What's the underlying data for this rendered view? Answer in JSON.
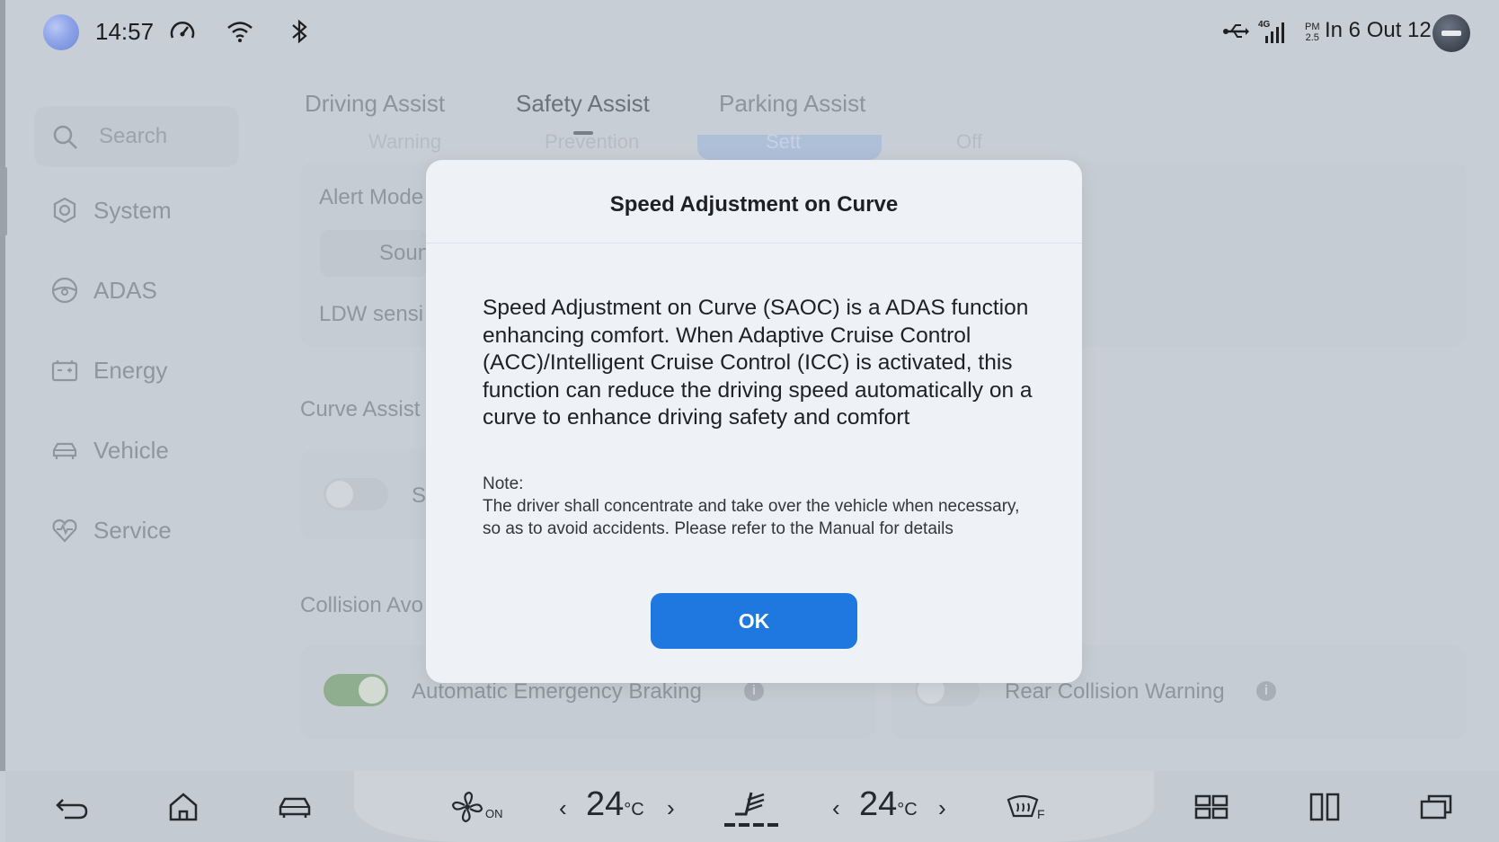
{
  "status_bar": {
    "time": "14:57",
    "right_text": "In 6 Out 12",
    "pm_label": "PM",
    "pm_value": "2.5",
    "network": "4G",
    "icons": [
      "app-logo-icon",
      "speedometer-icon",
      "wifi-icon",
      "bluetooth-icon",
      "usb-icon",
      "signal-icon",
      "avatar-icon"
    ]
  },
  "sidebar": {
    "search_placeholder": "Search",
    "items": [
      {
        "label": "System",
        "icon": "gear-icon"
      },
      {
        "label": "ADAS",
        "icon": "steering-icon"
      },
      {
        "label": "Energy",
        "icon": "battery-icon"
      },
      {
        "label": "Vehicle",
        "icon": "car-icon"
      },
      {
        "label": "Service",
        "icon": "heart-icon"
      }
    ]
  },
  "tabs": [
    {
      "label": "Driving Assist"
    },
    {
      "label": "Safety Assist",
      "active": true
    },
    {
      "label": "Parking Assist"
    }
  ],
  "subtabs": [
    "Warning",
    "Prevention",
    "Sett",
    "Off"
  ],
  "background": {
    "alert_mode_label": "Alert Mode",
    "sound_label": "Sound",
    "ldw_label": "LDW sensi",
    "curve_assist_label": "Curve Assist",
    "curve_toggle_text": "S",
    "collision_label": "Collision Avo",
    "aeb_label": "Automatic Emergency Braking",
    "rcw_label": "Rear Collision Warning",
    "info_glyph": "i"
  },
  "modal": {
    "title": "Speed Adjustment on Curve",
    "body": "Speed Adjustment on Curve (SAOC) is a ADAS function enhancing comfort. When Adaptive Cruise Control (ACC)/Intelligent Cruise Control (ICC) is activated, this function can reduce the driving speed automatically on a curve to enhance driving safety and comfort",
    "note_label": "Note:",
    "note": "The driver shall concentrate and take over the vehicle when necessary, so as to avoid accidents. Please refer to the Manual for details",
    "ok_label": "OK"
  },
  "dock": {
    "fan_status": "ON",
    "left_temp": "24",
    "right_temp": "24",
    "temp_unit": "°C",
    "arrow_left": "‹",
    "arrow_right": "›",
    "defrost_label": "F"
  },
  "colors": {
    "accent": "#1e78e0",
    "toggle_on": "#8fae8f"
  }
}
